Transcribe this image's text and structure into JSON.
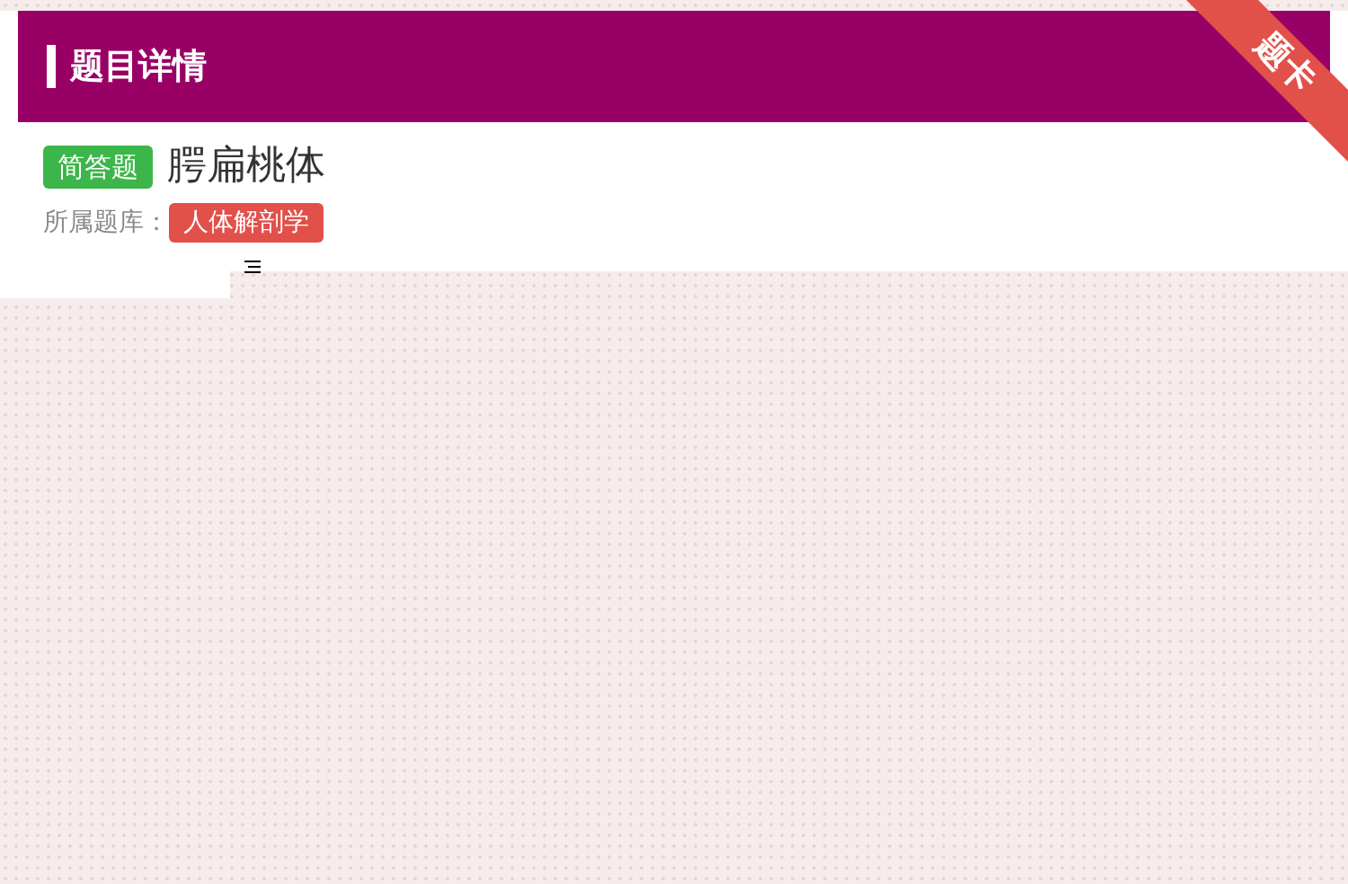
{
  "header": {
    "title": "题目详情"
  },
  "ribbon": {
    "label": "题卡"
  },
  "question": {
    "type_tag": "简答题",
    "title": "腭扁桃体"
  },
  "bank": {
    "label": "所属题库：",
    "tag": "人体解剖学"
  }
}
